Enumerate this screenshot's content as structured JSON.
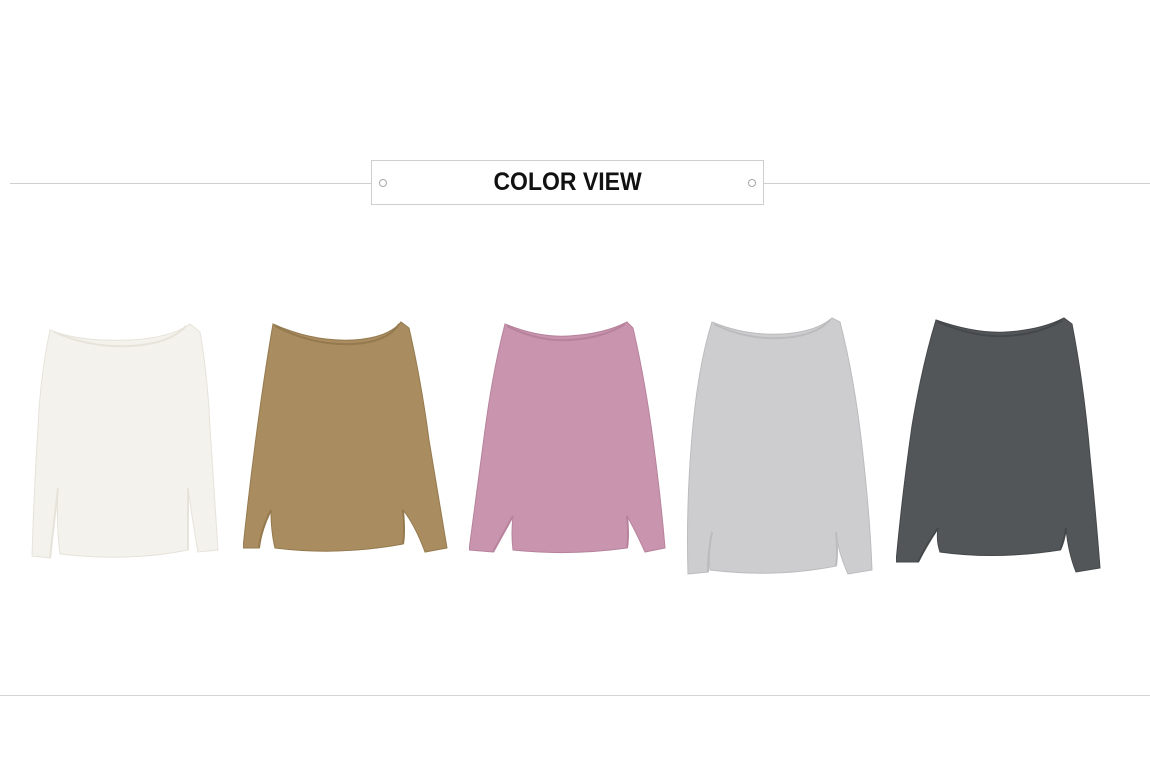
{
  "header": {
    "title": "COLOR VIEW"
  },
  "colors": {
    "rule_line": "#cfcfcf",
    "title_text": "#111111"
  },
  "products": [
    {
      "name": "sweater-ivory-icon",
      "color": "#f4f2ec",
      "shade": "#e6e3da"
    },
    {
      "name": "sweater-camel-icon",
      "color": "#a98d60",
      "shade": "#957a4f"
    },
    {
      "name": "sweater-pink-icon",
      "color": "#c995ae",
      "shade": "#b7829b"
    },
    {
      "name": "sweater-light-gray-icon",
      "color": "#cdcdcf",
      "shade": "#bcbcbe"
    },
    {
      "name": "sweater-charcoal-icon",
      "color": "#535658",
      "shade": "#45484a"
    }
  ]
}
